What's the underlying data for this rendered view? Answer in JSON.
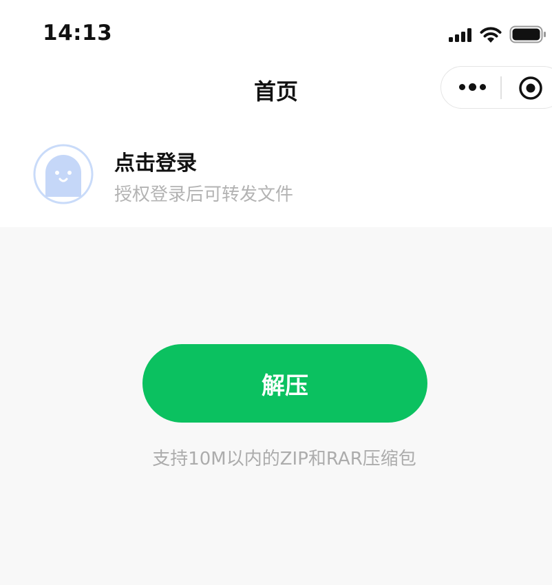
{
  "status_bar": {
    "time": "14:13",
    "icons": [
      "signal-icon",
      "wifi-icon",
      "battery-icon"
    ]
  },
  "nav": {
    "title": "首页",
    "capsule": {
      "menu_icon": "more-dots-icon",
      "close_icon": "target-circle-icon"
    }
  },
  "profile": {
    "title": "点击登录",
    "subtitle": "授权登录后可转发文件",
    "avatar_icon": "ghost-avatar-icon"
  },
  "main": {
    "button_label": "解压",
    "hint": "支持10M以内的ZIP和RAR压缩包"
  },
  "colors": {
    "accent": "#0BC160",
    "avatar": "#C5D7F8",
    "hint_text": "#ACACAC",
    "background": "#F8F8F8"
  }
}
